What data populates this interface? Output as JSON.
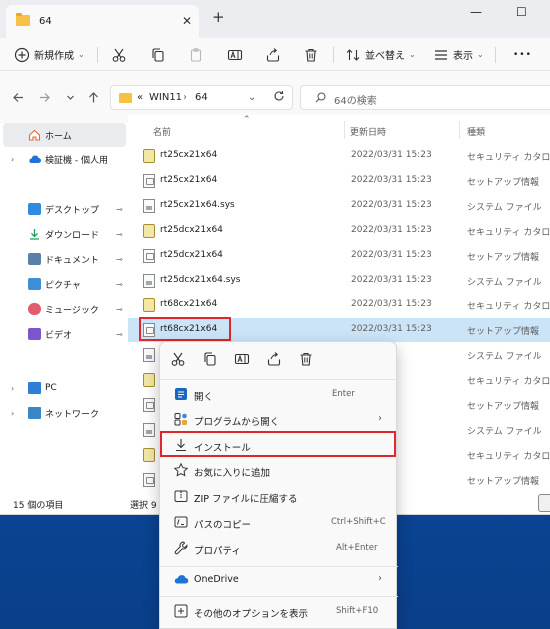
{
  "window": {
    "tab_title": "64",
    "tab_close": "✕",
    "new_tab": "+",
    "minimize": "—",
    "maximize": "☐"
  },
  "toolbar": {
    "new_label": "新規作成",
    "sort_label": "並べ替え",
    "view_label": "表示",
    "more_label": "•••",
    "caret": "⌄"
  },
  "address": {
    "overflow": "«",
    "crumb1": "WIN11",
    "sep": "›",
    "crumb2": "64",
    "dropdown": "⌄",
    "search_placeholder": "64の検索"
  },
  "sidebar": {
    "items": [
      {
        "label": "ホーム",
        "pinned": false
      },
      {
        "label": "検証機 - 個人用",
        "pinned": false
      },
      {
        "label": "デスクトップ",
        "pinned": true
      },
      {
        "label": "ダウンロード",
        "pinned": true
      },
      {
        "label": "ドキュメント",
        "pinned": true
      },
      {
        "label": "ピクチャ",
        "pinned": true
      },
      {
        "label": "ミュージック",
        "pinned": true
      },
      {
        "label": "ビデオ",
        "pinned": true
      },
      {
        "label": "PC",
        "pinned": false
      },
      {
        "label": "ネットワーク",
        "pinned": false
      }
    ],
    "pin_glyph": "📌"
  },
  "columns": {
    "name": "名前",
    "modified": "更新日時",
    "type": "種類"
  },
  "files": [
    {
      "name": "rt25cx21x64",
      "date": "2022/03/31 15:23",
      "type": "セキュリティ カタログ",
      "icon": "cat"
    },
    {
      "name": "rt25cx21x64",
      "date": "2022/03/31 15:23",
      "type": "セットアップ情報",
      "icon": "inf"
    },
    {
      "name": "rt25cx21x64.sys",
      "date": "2022/03/31 15:23",
      "type": "システム ファイル",
      "icon": "sys"
    },
    {
      "name": "rt25dcx21x64",
      "date": "2022/03/31 15:23",
      "type": "セキュリティ カタログ",
      "icon": "cat"
    },
    {
      "name": "rt25dcx21x64",
      "date": "2022/03/31 15:23",
      "type": "セットアップ情報",
      "icon": "inf"
    },
    {
      "name": "rt25dcx21x64.sys",
      "date": "2022/03/31 15:23",
      "type": "システム ファイル",
      "icon": "sys"
    },
    {
      "name": "rt68cx21x64",
      "date": "2022/03/31 15:23",
      "type": "セキュリティ カタログ",
      "icon": "cat"
    },
    {
      "name": "rt68cx21x64",
      "date": "2022/03/31 15:23",
      "type": "セットアップ情報",
      "icon": "inf",
      "selected": true
    },
    {
      "name": "",
      "date": "",
      "type": "システム ファイル",
      "icon": "sys"
    },
    {
      "name": "",
      "date": "",
      "type": "セキュリティ カタログ",
      "icon": "cat"
    },
    {
      "name": "",
      "date": "",
      "type": "セットアップ情報",
      "icon": "inf"
    },
    {
      "name": "",
      "date": "",
      "type": "システム ファイル",
      "icon": "sys"
    },
    {
      "name": "",
      "date": "",
      "type": "セキュリティ カタログ",
      "icon": "cat"
    },
    {
      "name": "",
      "date": "",
      "type": "セットアップ情報",
      "icon": "inf"
    }
  ],
  "status": {
    "count": "15 個の項目",
    "selection": "選択 9"
  },
  "context_menu": {
    "items": [
      {
        "label": "開く",
        "shortcut": "Enter",
        "submenu": false
      },
      {
        "label": "プログラムから開く",
        "shortcut": "",
        "submenu": true
      },
      {
        "label": "インストール",
        "shortcut": "",
        "submenu": false
      },
      {
        "label": "お気に入りに追加",
        "shortcut": "",
        "submenu": false
      },
      {
        "label": "ZIP ファイルに圧縮する",
        "shortcut": "",
        "submenu": false
      },
      {
        "label": "パスのコピー",
        "shortcut": "Ctrl+Shift+C",
        "submenu": false
      },
      {
        "label": "プロパティ",
        "shortcut": "Alt+Enter",
        "submenu": false
      },
      {
        "label": "OneDrive",
        "shortcut": "",
        "submenu": true
      },
      {
        "label": "その他のオプションを表示",
        "shortcut": "Shift+F10",
        "submenu": false
      }
    ],
    "submenu_glyph": "›"
  },
  "colors": {
    "accent": "#0067c0",
    "highlight_box": "#e0262e",
    "selection": "#cce4f7",
    "folder": "#f6c243"
  }
}
